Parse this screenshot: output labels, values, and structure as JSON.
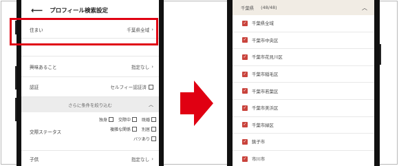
{
  "left_screen": {
    "title": "プロフィール検索設定",
    "rows": {
      "residence": {
        "label": "住まい",
        "value": "千葉県全域"
      },
      "hobby": {
        "label": "興味あること",
        "value": "指定なし"
      },
      "verification": {
        "label": "認証",
        "value": "セルフィー認証済"
      },
      "children": {
        "label": "子供",
        "value": "指定なし"
      }
    },
    "filter_heading": "さらに条件を絞り込む",
    "relationship_status": {
      "label": "交際ステータス",
      "options": [
        "独身",
        "交際中",
        "既婚",
        "複雑な関係",
        "別居",
        "バツあり"
      ]
    }
  },
  "right_screen": {
    "prefecture": "千葉県",
    "count": "(48/48)",
    "cities": [
      "千葉県全域",
      "千葉市中央区",
      "千葉市花見川区",
      "千葉市稲毛区",
      "千葉市若葉区",
      "千葉市美浜区",
      "千葉市緑区",
      "銚子市",
      "市川市"
    ]
  },
  "colors": {
    "highlight": "#e00012",
    "arrow": "#e00012",
    "checkbox_checked": "#c9433c",
    "prefecture_header_bg": "#f1ece4"
  }
}
